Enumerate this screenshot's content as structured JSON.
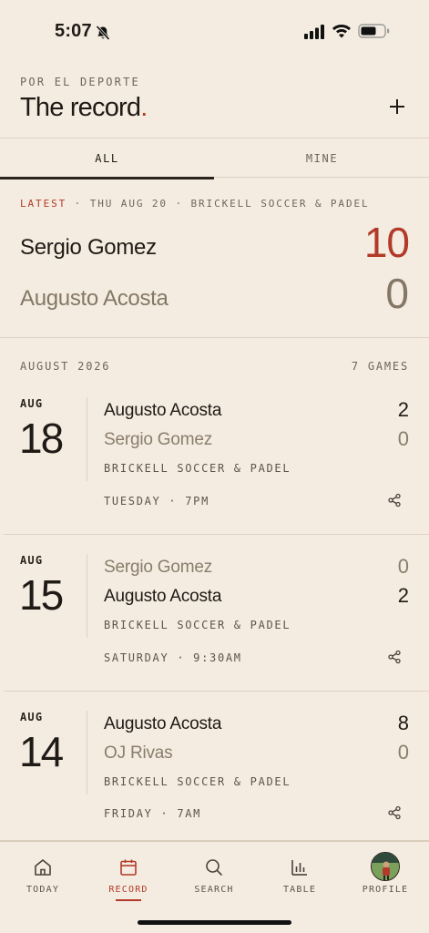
{
  "status_bar": {
    "time": "5:07"
  },
  "header": {
    "kicker": "POR EL DEPORTE",
    "title": "The record",
    "title_dot": "."
  },
  "tabs": [
    {
      "label": "ALL",
      "active": true
    },
    {
      "label": "MINE",
      "active": false
    }
  ],
  "latest": {
    "tag": "LATEST",
    "meta": " · THU AUG 20 · BRICKELL SOCCER & PADEL",
    "team1": {
      "name": "Sergio Gomez",
      "score": "10"
    },
    "team2": {
      "name": "Augusto Acosta",
      "score": "0"
    }
  },
  "month": {
    "label": "AUGUST 2026",
    "count": "7 GAMES"
  },
  "games": [
    {
      "month": "AUG",
      "day": "18",
      "team1": {
        "name": "Augusto Acosta",
        "score": "2",
        "winner": true
      },
      "team2": {
        "name": "Sergio Gomez",
        "score": "0",
        "winner": false
      },
      "venue": "BRICKELL SOCCER & PADEL",
      "time": "TUESDAY · 7PM"
    },
    {
      "month": "AUG",
      "day": "15",
      "team1": {
        "name": "Sergio Gomez",
        "score": "0",
        "winner": false
      },
      "team2": {
        "name": "Augusto Acosta",
        "score": "2",
        "winner": true
      },
      "venue": "BRICKELL SOCCER & PADEL",
      "time": "SATURDAY · 9:30AM"
    },
    {
      "month": "AUG",
      "day": "14",
      "team1": {
        "name": "Augusto Acosta",
        "score": "8",
        "winner": true
      },
      "team2": {
        "name": "OJ Rivas",
        "score": "0",
        "winner": false
      },
      "venue": "BRICKELL SOCCER & PADEL",
      "time": "FRIDAY · 7AM"
    }
  ],
  "nav": [
    {
      "label": "TODAY",
      "icon": "home-icon",
      "active": false
    },
    {
      "label": "RECORD",
      "icon": "calendar-icon",
      "active": true
    },
    {
      "label": "SEARCH",
      "icon": "search-icon",
      "active": false
    },
    {
      "label": "TABLE",
      "icon": "bar-chart-icon",
      "active": false
    },
    {
      "label": "PROFILE",
      "icon": "avatar",
      "active": false
    }
  ],
  "colors": {
    "accent": "#b23a2a",
    "background": "#f4ece0",
    "ink": "#1f1a16",
    "muted": "#847766"
  }
}
